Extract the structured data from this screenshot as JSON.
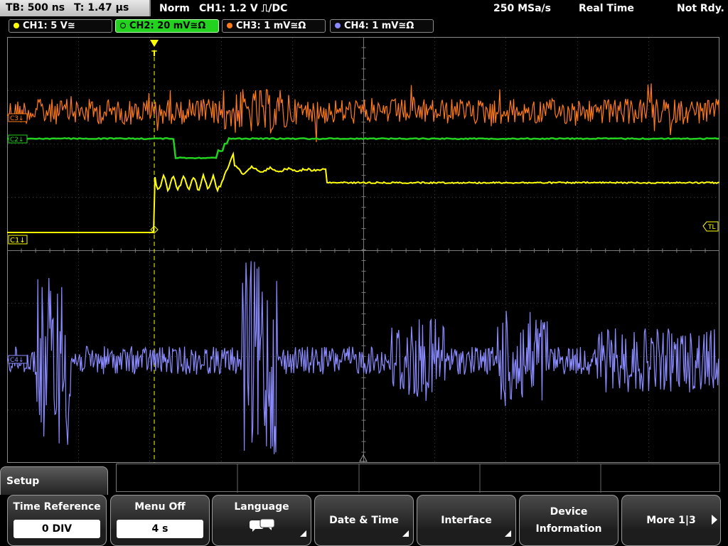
{
  "topbar": {
    "timebase": "TB: 500 ns",
    "trigger_time": "T: 1.47 µs",
    "mode": "Norm",
    "trigger": "CH1: 1.2 V ⎍/DC",
    "sample_rate": "250 MSa/s",
    "acq_mode": "Real Time",
    "status": "Not Rdy."
  },
  "channels": [
    {
      "label": "CH1: 5 V≅",
      "color": "#ffff00"
    },
    {
      "label": "CH2: 20 mV≅Ω",
      "color": "#22d21e"
    },
    {
      "label": "CH3: 1 mV≅Ω",
      "color": "#ff7a1a"
    },
    {
      "label": "CH4: 1 mV≅Ω",
      "color": "#8a8aff"
    }
  ],
  "markers": {
    "c1": "C1↓",
    "c2": "C2↓",
    "c3": "C3↓",
    "c4": "C4↓",
    "trigger_level": "TL",
    "trigger_pos": "T"
  },
  "menu": {
    "title": "Setup",
    "softkeys": [
      {
        "label": "Time Reference",
        "value": "0 DIV"
      },
      {
        "label": "Menu Off",
        "value": "4 s"
      },
      {
        "label": "Language",
        "icon": "speech-bubbles-icon"
      },
      {
        "label": "Date & Time"
      },
      {
        "label": "Interface"
      },
      {
        "label_line1": "Device",
        "label_line2": "Information"
      },
      {
        "label": "More 1|3"
      }
    ]
  }
}
